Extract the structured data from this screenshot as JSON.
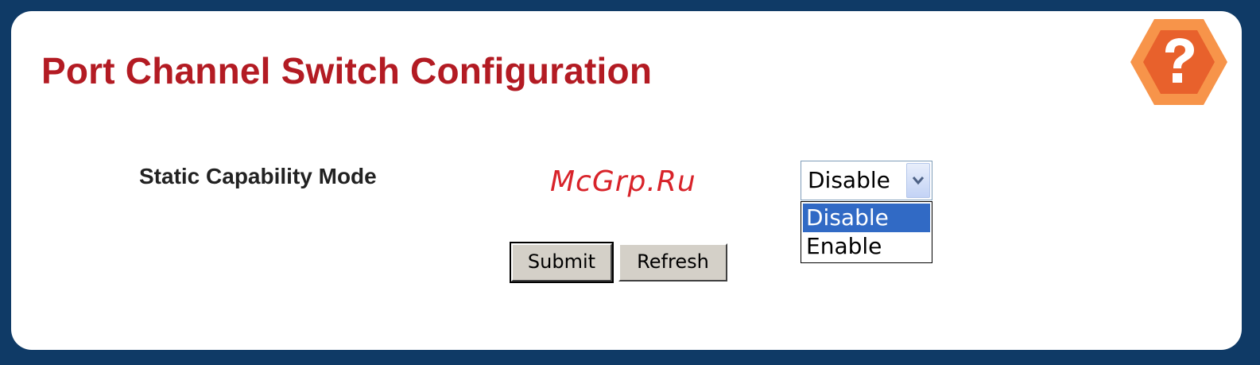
{
  "header": {
    "title": "Port Channel Switch Configuration",
    "help_icon": "help-question-icon"
  },
  "form": {
    "label": "Static Capability Mode",
    "select": {
      "value": "Disable",
      "options": [
        {
          "label": "Disable",
          "selected": true
        },
        {
          "label": "Enable",
          "selected": false
        }
      ]
    },
    "buttons": {
      "submit": "Submit",
      "refresh": "Refresh"
    }
  },
  "watermark": "McGrp.Ru",
  "colors": {
    "background": "#0f3a66",
    "title": "#b31b23",
    "help_outer": "#f7944a",
    "help_inner": "#e8612c",
    "selection": "#316ac5",
    "watermark": "#d8232a"
  }
}
